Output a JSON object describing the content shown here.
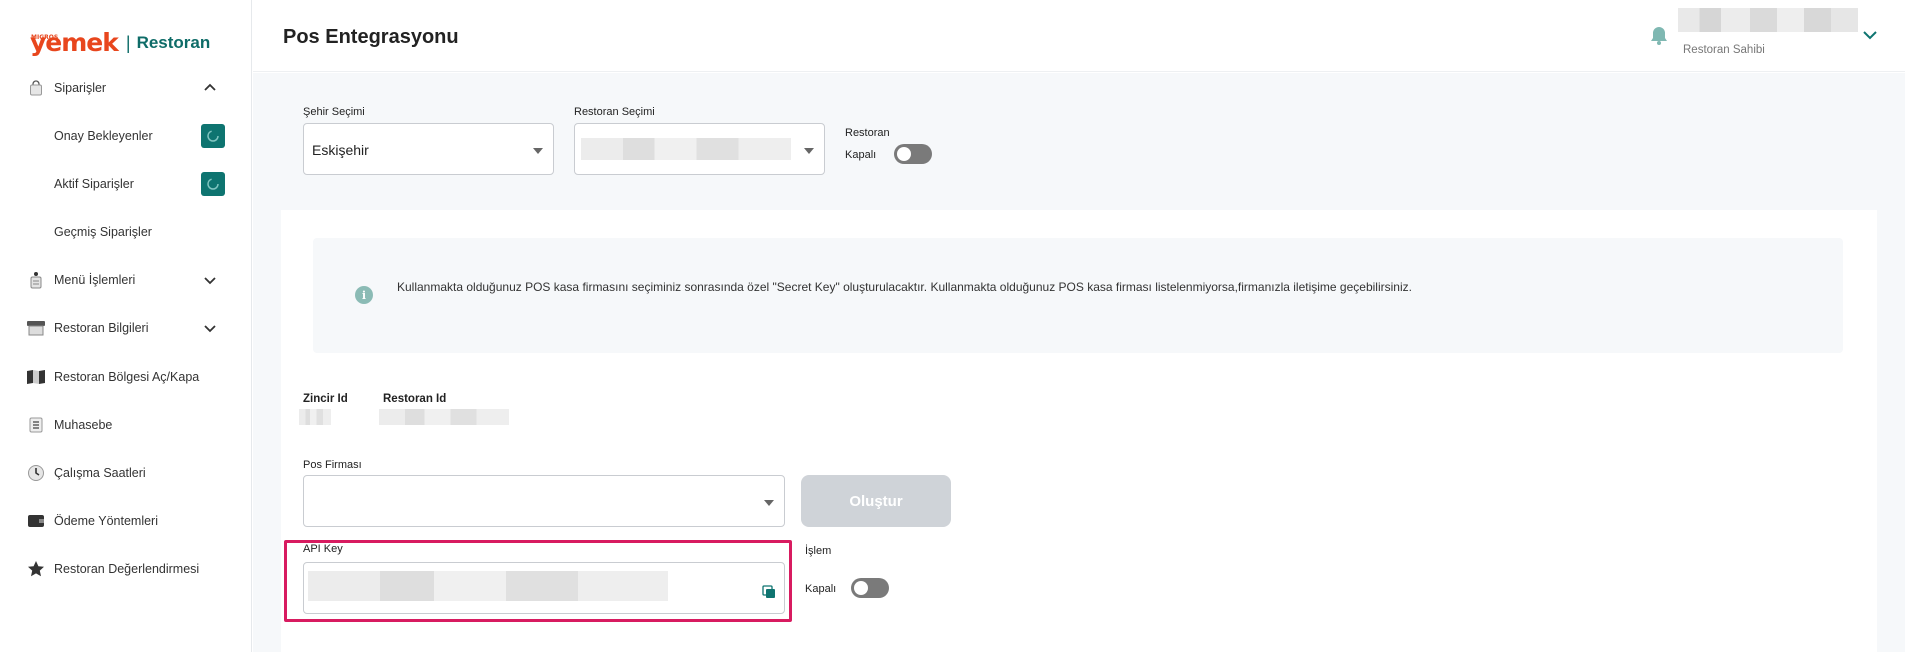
{
  "logo": {
    "superscript": "MIGROS",
    "brand": "yemek",
    "separator": "|",
    "product": "Restoran"
  },
  "sidebar": {
    "items": [
      {
        "label": "Siparişler",
        "icon": "bag-icon",
        "expanded": true
      },
      {
        "label": "Menü İşlemleri",
        "icon": "menu-book-icon",
        "expanded": false
      },
      {
        "label": "Restoran Bilgileri",
        "icon": "store-icon",
        "expanded": false
      },
      {
        "label": "Restoran Bölgesi Aç/Kapa",
        "icon": "map-icon"
      },
      {
        "label": "Muhasebe",
        "icon": "list-icon"
      },
      {
        "label": "Çalışma Saatleri",
        "icon": "clock-icon"
      },
      {
        "label": "Ödeme Yöntemleri",
        "icon": "wallet-icon"
      },
      {
        "label": "Restoran Değerlendirmesi",
        "icon": "star-icon"
      }
    ],
    "sub_items": [
      {
        "label": "Onay Bekleyenler",
        "badge": "spinner-icon"
      },
      {
        "label": "Aktif Siparişler",
        "badge": "spinner-icon"
      },
      {
        "label": "Geçmiş Siparişler"
      }
    ]
  },
  "header": {
    "title": "Pos Entegrasyonu",
    "user_role": "Restoran Sahibi"
  },
  "filters": {
    "city_label": "Şehir Seçimi",
    "city_value": "Eskişehir",
    "restaurant_label": "Restoran Seçimi",
    "restaurant_status_label": "Restoran",
    "restaurant_status_value": "Kapalı"
  },
  "info": {
    "text": "Kullanmakta olduğunuz POS kasa firmasını seçiminiz sonrasında özel \"Secret Key\" oluşturulacaktır. Kullanmakta olduğunuz POS kasa firması listelenmiyorsa,firmanızla iletişime geçebilirsiniz."
  },
  "ids": {
    "chain_label": "Zincir Id",
    "restaurant_label": "Restoran Id"
  },
  "pos": {
    "company_label": "Pos Firması",
    "company_value": "",
    "create_button": "Oluştur",
    "api_key_label": "API Key",
    "action_label": "İşlem",
    "action_status": "Kapalı"
  },
  "colors": {
    "brand_orange": "#e8461d",
    "brand_teal": "#0e7470",
    "highlight": "#d81b60"
  }
}
